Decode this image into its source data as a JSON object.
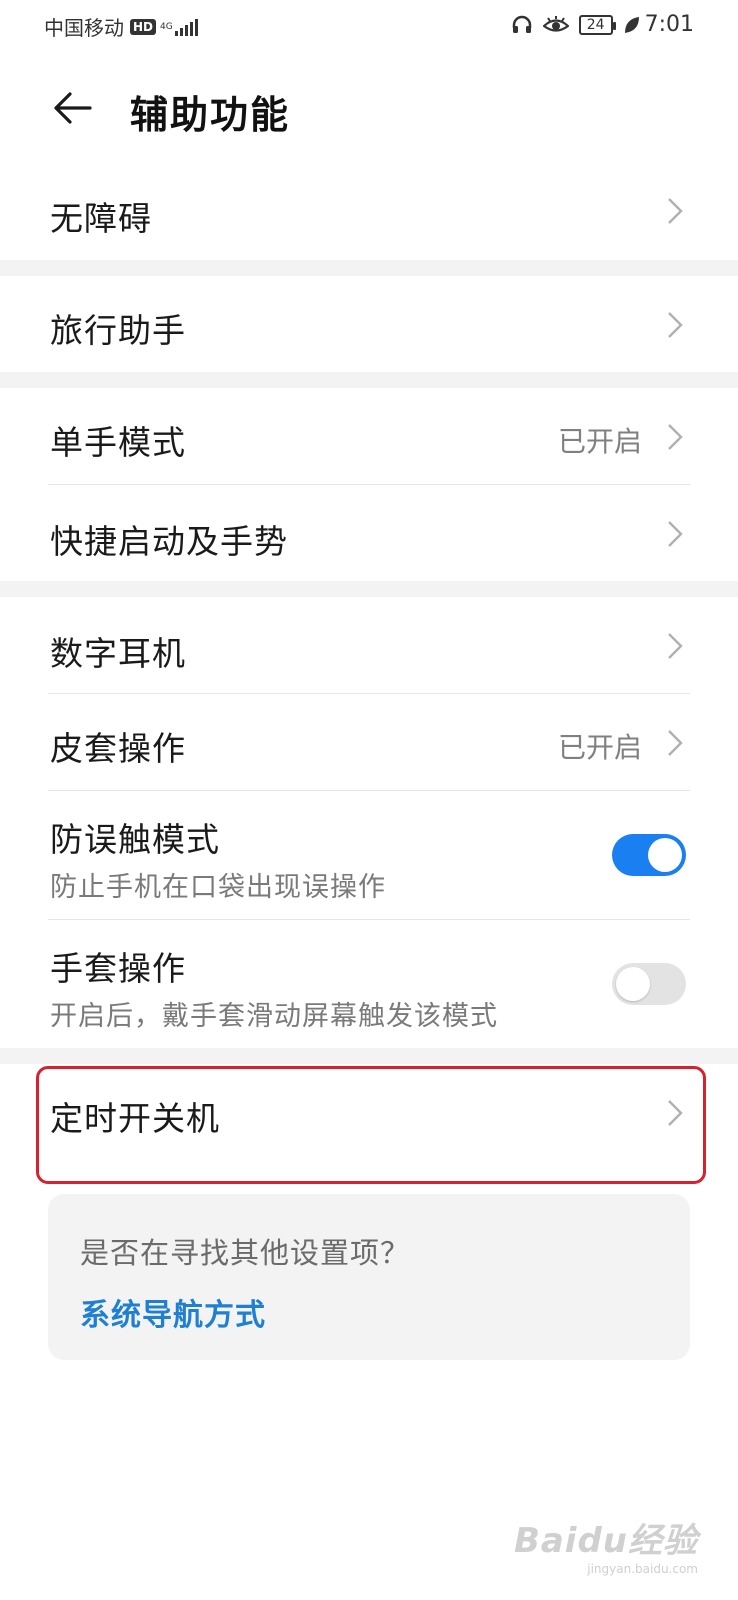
{
  "status_bar": {
    "carrier": "中国移动",
    "hd": "HD",
    "network": "4G",
    "battery": "24",
    "time": "7:01",
    "icons": [
      "headset-icon",
      "eye-comfort-icon",
      "battery-icon",
      "leaf-icon"
    ]
  },
  "header": {
    "title": "辅助功能",
    "back_icon": "back-arrow-icon"
  },
  "rows": [
    {
      "title": "无障碍"
    },
    {
      "title": "旅行助手"
    },
    {
      "title": "单手模式",
      "value": "已开启"
    },
    {
      "title": "快捷启动及手势"
    },
    {
      "title": "数字耳机"
    },
    {
      "title": "皮套操作",
      "value": "已开启"
    },
    {
      "title": "防误触模式",
      "subtitle": "防止手机在口袋出现误操作",
      "toggle": "on"
    },
    {
      "title": "手套操作",
      "subtitle": "开启后，戴手套滑动屏幕触发该模式",
      "toggle": "off"
    },
    {
      "title": "定时开关机"
    }
  ],
  "suggestion": {
    "question": "是否在寻找其他设置项？",
    "link": "系统导航方式"
  },
  "watermark": {
    "logo": "Baidu经验",
    "url": "jingyan.baidu.com"
  },
  "colors": {
    "accent": "#1a7ff0",
    "link": "#1f7fd1",
    "highlight": "#d8202e"
  }
}
